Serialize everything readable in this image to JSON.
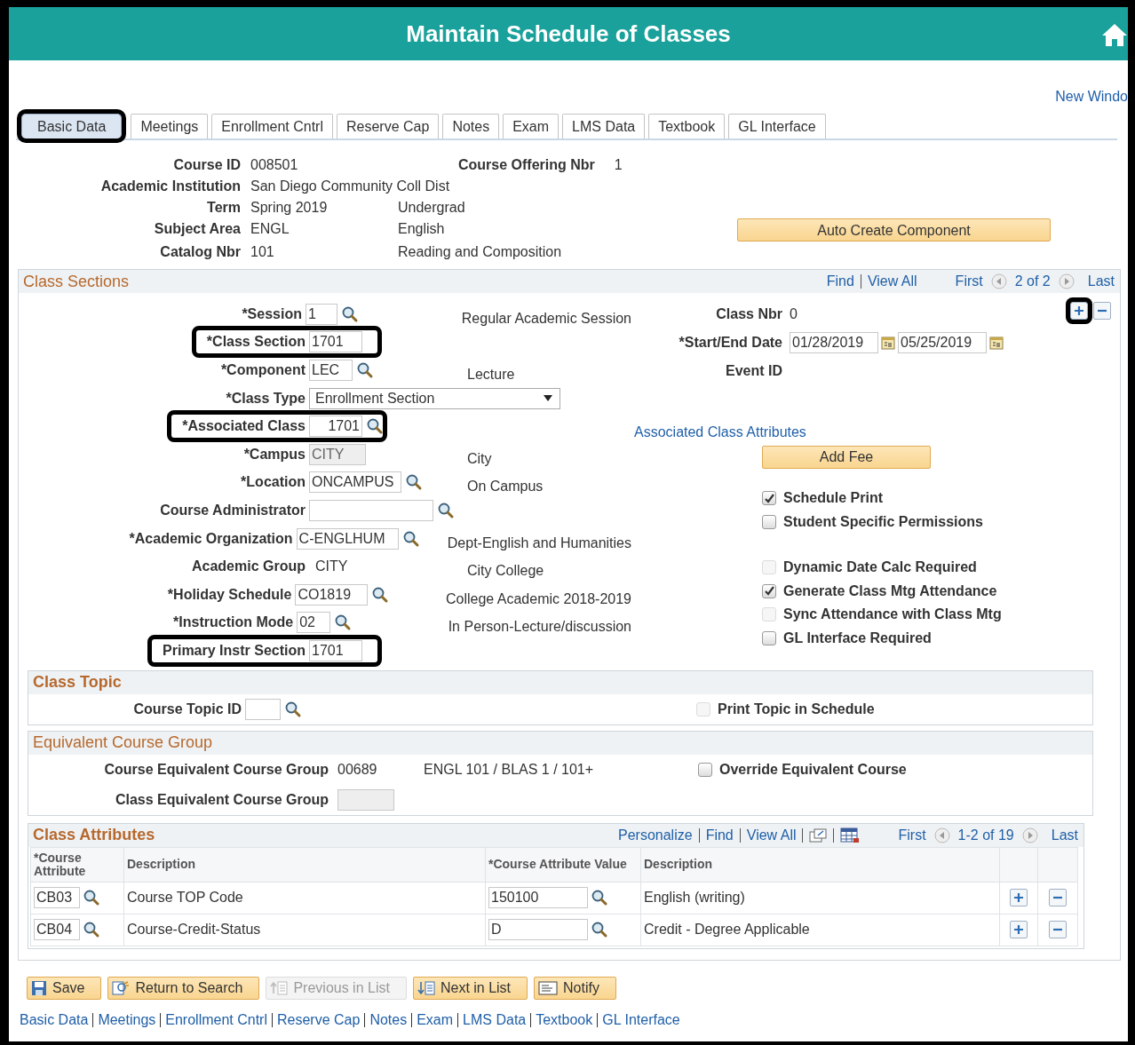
{
  "title": "Maintain Schedule of Classes",
  "new_window": "New Windo",
  "tabs": [
    {
      "label": "Basic Data",
      "selected": true,
      "highlighted": true
    },
    {
      "label": "Meetings",
      "selected": false,
      "highlighted": false
    },
    {
      "label": "Enrollment Cntrl",
      "selected": false,
      "highlighted": false
    },
    {
      "label": "Reserve Cap",
      "selected": false,
      "highlighted": false
    },
    {
      "label": "Notes",
      "selected": false,
      "highlighted": false
    },
    {
      "label": "Exam",
      "selected": false,
      "highlighted": false
    },
    {
      "label": "LMS Data",
      "selected": false,
      "highlighted": false
    },
    {
      "label": "Textbook",
      "selected": false,
      "highlighted": false
    },
    {
      "label": "GL Interface",
      "selected": false,
      "highlighted": false
    }
  ],
  "header": {
    "fields": [
      {
        "label": "Course ID",
        "value": "008501"
      },
      {
        "label": "Academic Institution",
        "value": "San Diego Community Coll Dist"
      },
      {
        "label": "Term",
        "value": "Spring 2019",
        "extra": "Undergrad"
      },
      {
        "label": "Subject Area",
        "value": "ENGL",
        "extra": "English"
      },
      {
        "label": "Catalog Nbr",
        "value": "101",
        "extra": "Reading and Composition"
      }
    ],
    "offering": {
      "label": "Course Offering Nbr",
      "value": "1"
    },
    "button": "Auto Create Component"
  },
  "class_sections": {
    "title": "Class Sections",
    "nav": {
      "find": "Find",
      "view_all": "View All",
      "first": "First",
      "count": "2 of 2",
      "last": "Last"
    },
    "add_highlighted": true,
    "fields": [
      {
        "label": "*Session",
        "kind": "input",
        "value": "1",
        "lookup": true,
        "highlighted": false,
        "description": "Regular Academic Session"
      },
      {
        "label": "*Class Section",
        "kind": "input",
        "value": "1701",
        "lookup": false,
        "highlighted": true
      },
      {
        "label": "*Component",
        "kind": "input",
        "value": "LEC",
        "lookup": true,
        "highlighted": false,
        "description": "Lecture"
      },
      {
        "label": "*Class Type",
        "kind": "select",
        "value": "Enrollment Section",
        "lookup": false,
        "highlighted": false
      },
      {
        "label": "*Associated Class",
        "kind": "right-input",
        "value": "1701",
        "lookup": true,
        "highlighted": true
      },
      {
        "label": "*Campus",
        "kind": "readonly",
        "value": "CITY",
        "lookup": false,
        "highlighted": false,
        "description": "City"
      },
      {
        "label": "*Location",
        "kind": "input",
        "value": "ONCAMPUS",
        "lookup": true,
        "highlighted": false,
        "description": "On Campus"
      },
      {
        "label": "Course Administrator",
        "kind": "input",
        "lookup": true,
        "highlighted": false
      },
      {
        "label": "*Academic Organization",
        "kind": "input",
        "value": "C-ENGLHUM",
        "lookup": true,
        "highlighted": false,
        "description": "Dept-English and Humanities"
      },
      {
        "label": "Academic Group",
        "kind": "text",
        "value": "CITY",
        "lookup": false,
        "highlighted": false,
        "description": "City College"
      },
      {
        "label": "*Holiday Schedule",
        "kind": "input",
        "value": "CO1819",
        "lookup": true,
        "highlighted": false,
        "description": "College Academic 2018-2019"
      },
      {
        "label": "*Instruction Mode",
        "kind": "input",
        "value": "02",
        "lookup": true,
        "highlighted": false,
        "description": "In Person-Lecture/discussion"
      },
      {
        "label": "Primary Instr Section",
        "kind": "input",
        "value": "1701",
        "lookup": false,
        "highlighted": true
      }
    ],
    "class_nbr": {
      "label": "Class Nbr",
      "value": "0"
    },
    "dates": {
      "label": "*Start/End Date",
      "start": "01/28/2019",
      "end": "05/25/2019"
    },
    "event_id": "Event ID",
    "attributes_link": "Associated Class Attributes",
    "add_fee": "Add Fee",
    "checkboxes": [
      {
        "label": "Schedule Print",
        "checked": true,
        "disabled": false
      },
      {
        "label": "Student Specific Permissions",
        "checked": false,
        "disabled": false
      },
      {
        "label": "Dynamic Date Calc Required",
        "checked": false,
        "disabled": true
      },
      {
        "label": "Generate Class Mtg Attendance",
        "checked": true,
        "disabled": false
      },
      {
        "label": "Sync Attendance with Class Mtg",
        "checked": false,
        "disabled": true
      },
      {
        "label": "GL Interface Required",
        "checked": false,
        "disabled": false
      }
    ]
  },
  "class_topic": {
    "title": "Class Topic",
    "label": "Course Topic ID",
    "checkbox": {
      "label": "Print Topic in Schedule",
      "checked": false,
      "disabled": true
    }
  },
  "equivalent": {
    "title": "Equivalent Course Group",
    "course_label": "Course Equivalent Course Group",
    "course_value": "00689",
    "course_desc": "ENGL 101 / BLAS 1 / 101+",
    "checkbox": {
      "label": "Override Equivalent Course",
      "checked": false,
      "disabled": false
    },
    "class_label": "Class Equivalent Course Group"
  },
  "class_attributes": {
    "title": "Class Attributes",
    "nav": {
      "personalize": "Personalize",
      "find": "Find",
      "view_all": "View All",
      "first": "First",
      "count": "1-2 of 19",
      "last": "Last"
    },
    "columns": [
      "*Course Attribute",
      "Description",
      "*Course Attribute Value",
      "Description"
    ],
    "rows": [
      {
        "attribute": "CB03",
        "description": "Course TOP Code",
        "value": "150100",
        "value_description": "English (writing)"
      },
      {
        "attribute": "CB04",
        "description": "Course-Credit-Status",
        "value": "D",
        "value_description": "Credit - Degree Applicable"
      }
    ]
  },
  "buttons": [
    {
      "label": "Save",
      "kind": "save",
      "disabled": false
    },
    {
      "label": "Return to Search",
      "kind": "search",
      "disabled": false
    },
    {
      "label": "Previous in List",
      "kind": "previous",
      "disabled": true
    },
    {
      "label": "Next in List",
      "kind": "next",
      "disabled": false
    },
    {
      "label": "Notify",
      "kind": "notify",
      "disabled": false
    }
  ],
  "footer_links": [
    "Basic Data",
    "Meetings",
    "Enrollment Cntrl",
    "Reserve Cap",
    "Notes",
    "Exam",
    "LMS Data",
    "Textbook",
    "GL Interface"
  ]
}
